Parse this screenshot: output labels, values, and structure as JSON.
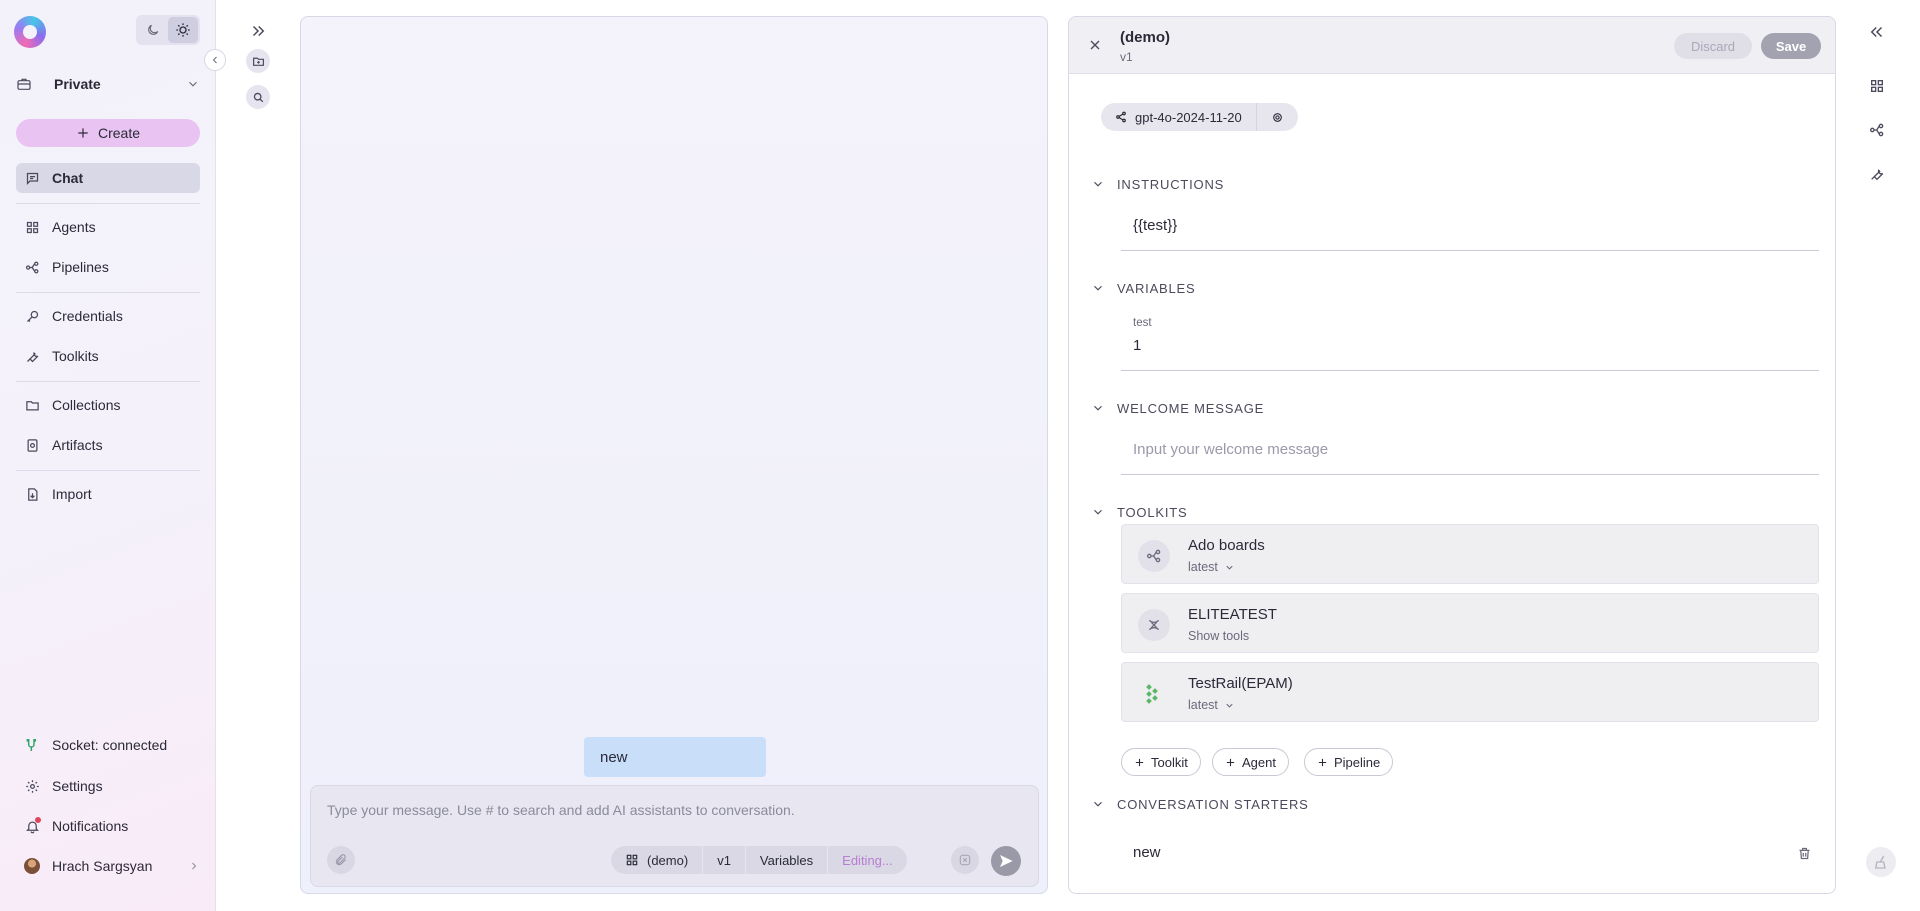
{
  "sidebar": {
    "workspace": "Private",
    "create_label": "Create",
    "nav": [
      {
        "label": "Chat",
        "icon": "chat-icon",
        "active": true
      },
      {
        "label": "Agents",
        "icon": "grid-icon"
      },
      {
        "label": "Pipelines",
        "icon": "pipeline-icon"
      },
      {
        "label": "Credentials",
        "icon": "key-icon"
      },
      {
        "label": "Toolkits",
        "icon": "wrench-icon"
      },
      {
        "label": "Collections",
        "icon": "folder-icon"
      },
      {
        "label": "Artifacts",
        "icon": "artifact-icon"
      },
      {
        "label": "Import",
        "icon": "import-icon"
      }
    ],
    "bottom": {
      "socket": "Socket: connected",
      "settings": "Settings",
      "notifications": "Notifications",
      "user": "Hrach Sargsyan"
    }
  },
  "chat": {
    "starter_chip": "new",
    "composer_placeholder": "Type your message. Use # to search and add AI assistants to conversation.",
    "context": {
      "agent": "(demo)",
      "version": "v1",
      "variables": "Variables",
      "status": "Editing..."
    }
  },
  "editor": {
    "title": "(demo)",
    "version": "v1",
    "discard_label": "Discard",
    "save_label": "Save",
    "model": "gpt-4o-2024-11-20",
    "sections": {
      "instructions": "INSTRUCTIONS",
      "variables": "VARIABLES",
      "welcome": "WELCOME MESSAGE",
      "toolkits": "TOOLKITS",
      "starters": "CONVERSATION STARTERS"
    },
    "instructions_value": "{{test}}",
    "variable": {
      "name": "test",
      "value": "1"
    },
    "welcome_placeholder": "Input your welcome message",
    "toolkits": [
      {
        "name": "Ado boards",
        "sub": "latest",
        "icon": "pipeline-icon"
      },
      {
        "name": "ELITEATEST",
        "sub": "Show tools",
        "icon": "toolkit-icon"
      },
      {
        "name": "TestRail(EPAM)",
        "sub": "latest",
        "icon": "testrail-icon"
      }
    ],
    "add_buttons": {
      "toolkit": "Toolkit",
      "agent": "Agent",
      "pipeline": "Pipeline"
    },
    "starter": "new"
  },
  "colors": {
    "accent_pink": "#e9c4f2",
    "starter_chip": "#c9def9",
    "editing_text": "#b77ed1",
    "socket_green": "#2fa36b",
    "notification_dot": "#e0445a"
  }
}
